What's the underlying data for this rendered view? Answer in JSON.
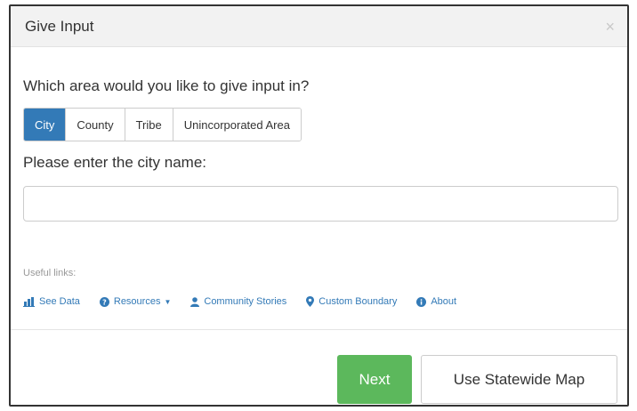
{
  "modal": {
    "title": "Give Input",
    "close_label": "×"
  },
  "body": {
    "question": "Which area would you like to give input in?",
    "area_options": [
      {
        "label": "City",
        "active": true
      },
      {
        "label": "County",
        "active": false
      },
      {
        "label": "Tribe",
        "active": false
      },
      {
        "label": "Unincorporated Area",
        "active": false
      }
    ],
    "prompt": "Please enter the city name:",
    "city_input": {
      "value": "",
      "placeholder": ""
    }
  },
  "useful_links": {
    "heading": "Useful links:",
    "items": [
      {
        "label": "See Data",
        "icon": "bar-chart-icon"
      },
      {
        "label": "Resources",
        "icon": "question-circle-icon",
        "dropdown": true
      },
      {
        "label": "Community Stories",
        "icon": "user-icon"
      },
      {
        "label": "Custom Boundary",
        "icon": "map-marker-icon"
      },
      {
        "label": "About",
        "icon": "info-circle-icon"
      }
    ]
  },
  "footer": {
    "next_label": "Next",
    "statewide_label": "Use Statewide Map"
  },
  "colors": {
    "primary": "#337ab7",
    "success": "#5cb85c",
    "header_bg": "#f2f2f2"
  }
}
